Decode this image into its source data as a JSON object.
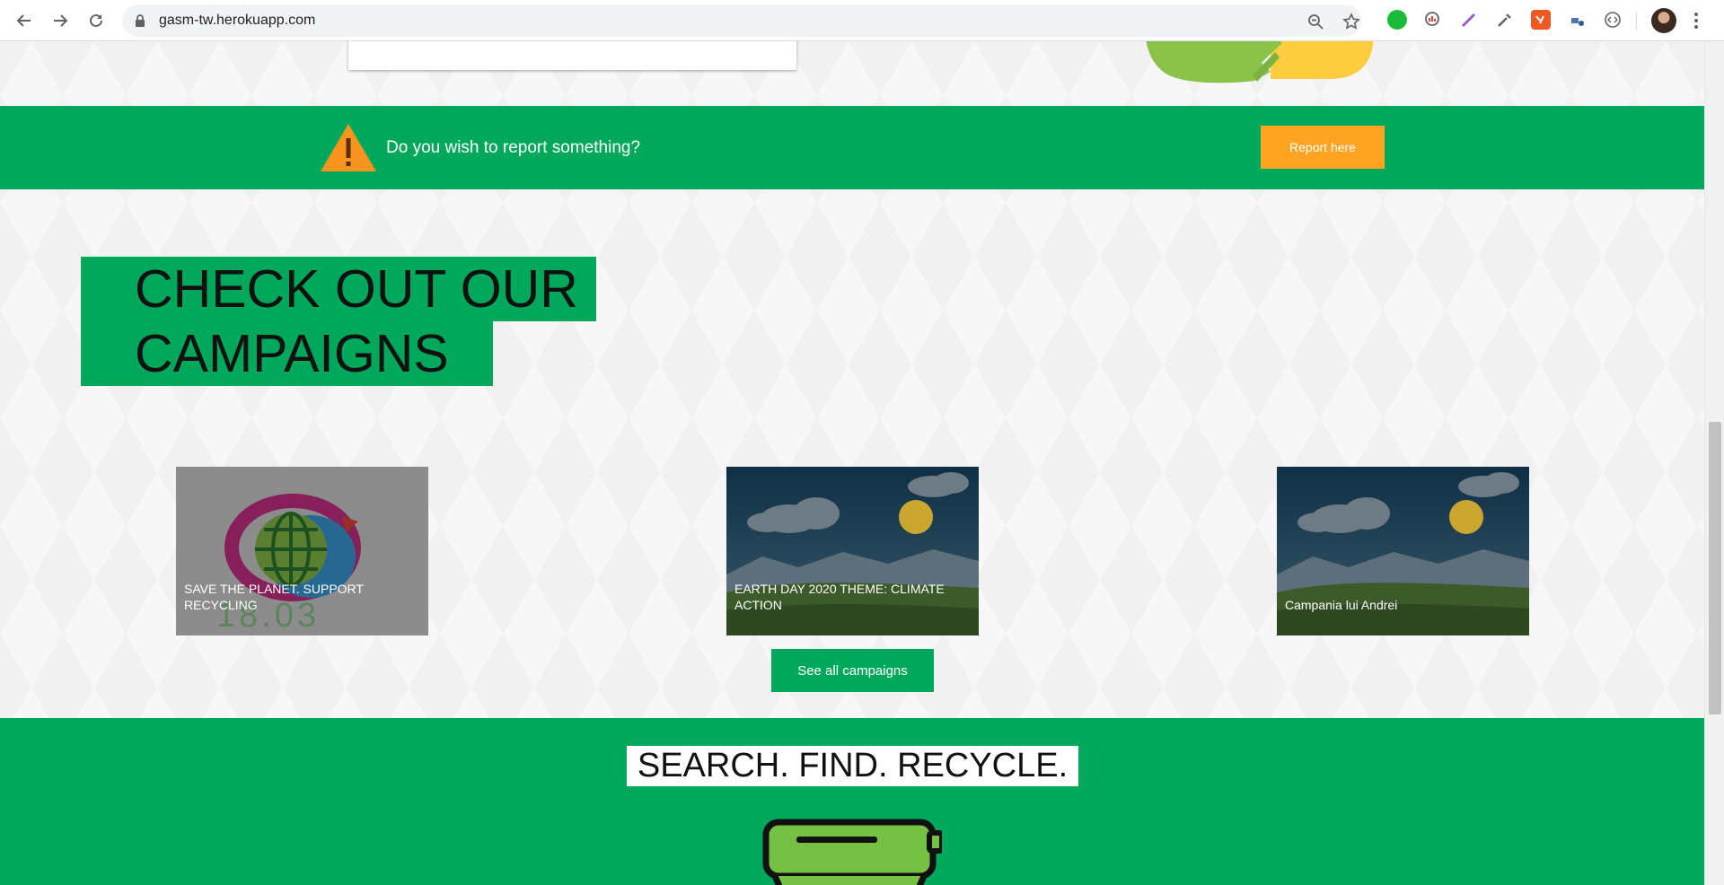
{
  "browser": {
    "url": "gasm-tw.herokuapp.com",
    "icons": {
      "back": "arrow-left-icon",
      "forward": "arrow-right-icon",
      "reload": "reload-icon",
      "zoom": "zoom-icon",
      "bookmark": "star-icon",
      "menu": "kebab-menu-icon"
    }
  },
  "report": {
    "prompt": "Do you wish to report something?",
    "button_label": "Report here"
  },
  "campaigns": {
    "title_line1": "CHECK OUT OUR",
    "title_line2": "CAMPAIGNS",
    "items": [
      {
        "title": "SAVE THE PLANET. SUPPORT RECYCLING",
        "image_text": "18.03"
      },
      {
        "title": "EARTH DAY 2020 THEME: CLIMATE ACTION"
      },
      {
        "title": "Campania lui Andrei"
      }
    ],
    "see_all_label": "See all campaigns"
  },
  "search": {
    "title": "SEARCH. FIND. RECYCLE."
  },
  "colors": {
    "brand_green": "#00a85c",
    "orange": "#ffa321",
    "page_bg": "#f7f7f7"
  }
}
